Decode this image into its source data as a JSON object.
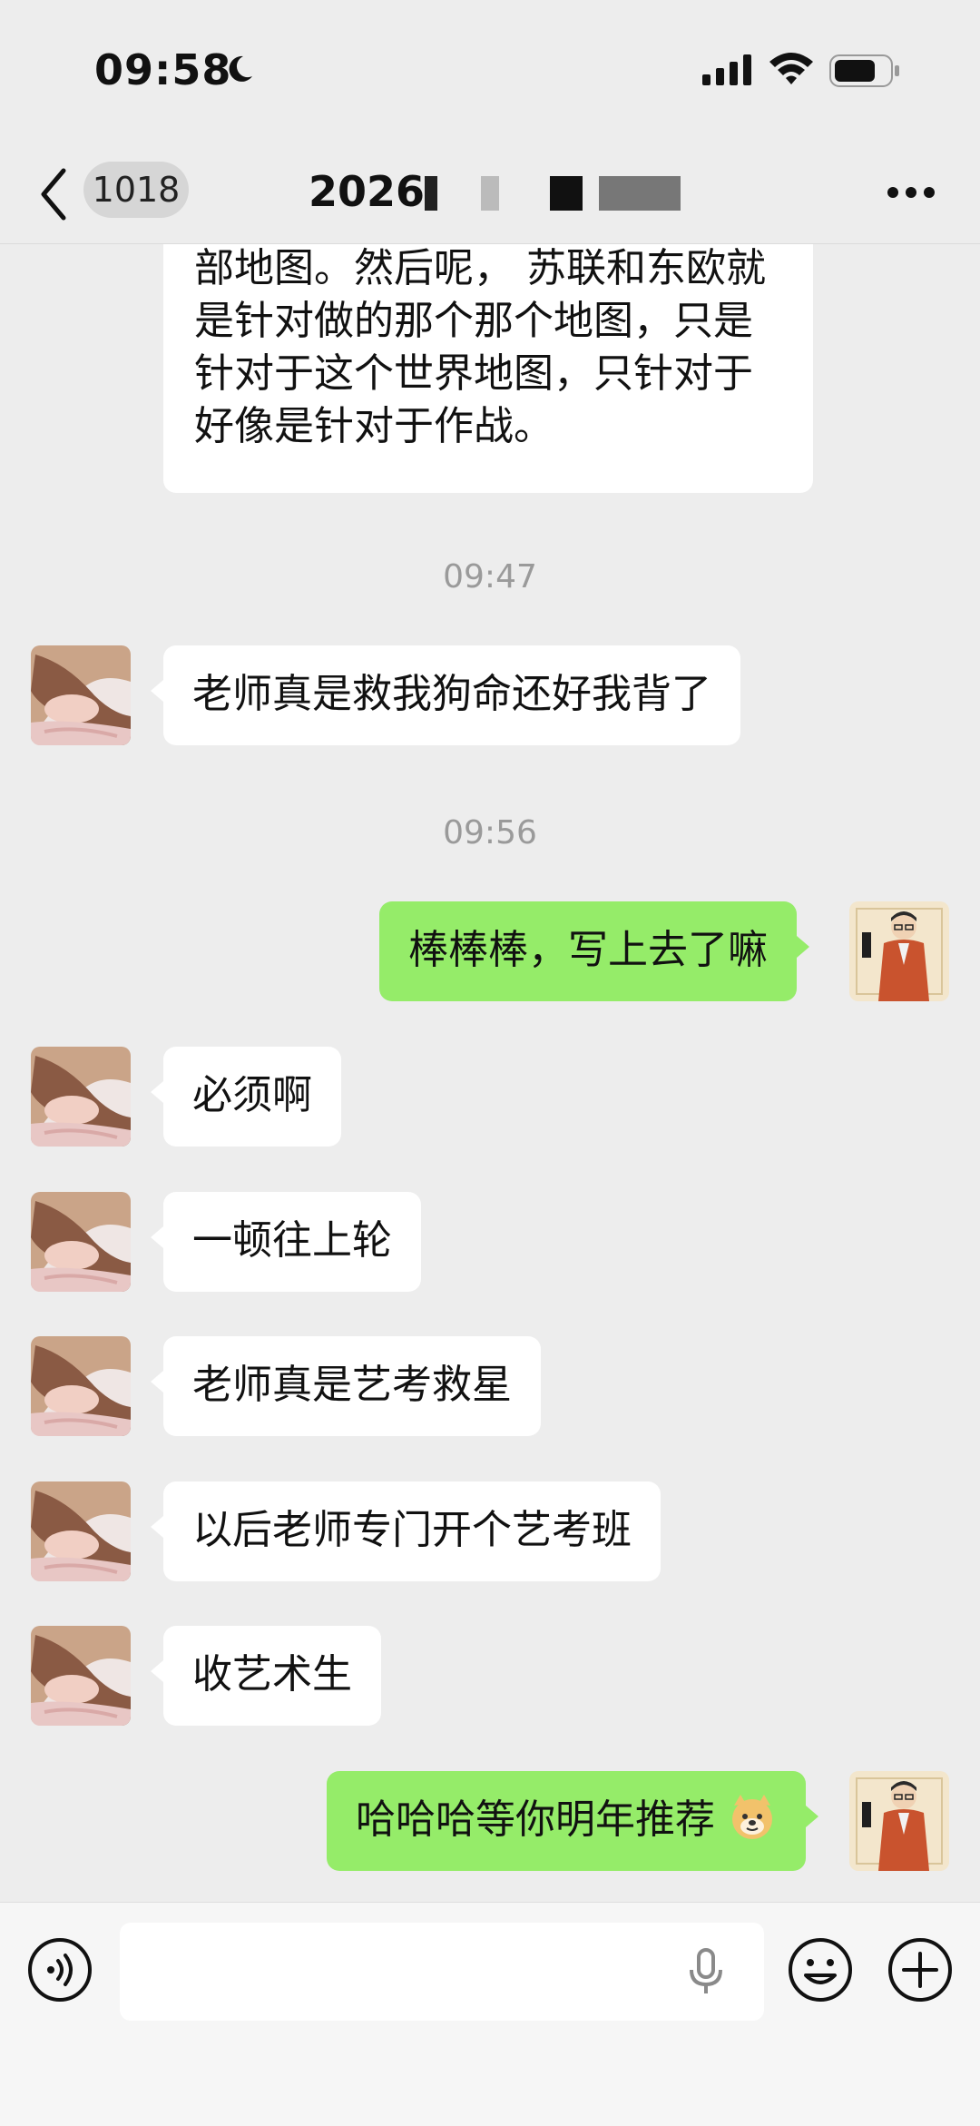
{
  "status_bar": {
    "time": "09:58",
    "icons": [
      "moon-icon",
      "signal-icon",
      "wifi-icon",
      "battery-icon"
    ]
  },
  "nav": {
    "unread_count": "1018",
    "title": "2026",
    "icons": [
      "chevron-left-icon",
      "more-icon"
    ]
  },
  "messages": {
    "partial_incoming": "部地图。然后呢，   苏联和东欧就是针对做的那个那个地图，只是针对于这个世界地图，只针对于好像是针对于作战。",
    "time_1": "09:47",
    "msg_1": "老师真是救我狗命还好我背了",
    "time_2": "09:56",
    "msg_2": "棒棒棒，写上去了嘛",
    "msg_3": "必须啊",
    "msg_4": "一顿往上轮",
    "msg_5": "老师真是艺考救星",
    "msg_6": "以后老师专门开个艺考班",
    "msg_7": "收艺术生",
    "msg_8": "哈哈哈等你明年推荐",
    "msg_8_emoji": "doge-emoji-icon"
  },
  "input_bar": {
    "placeholder": "",
    "icons": [
      "voice-icon",
      "mic-icon",
      "emoji-icon",
      "plus-icon"
    ]
  },
  "colors": {
    "background": "#ededed",
    "outgoing_bubble": "#95ec69",
    "incoming_bubble": "#ffffff",
    "timestamp": "#9a9a9a"
  }
}
